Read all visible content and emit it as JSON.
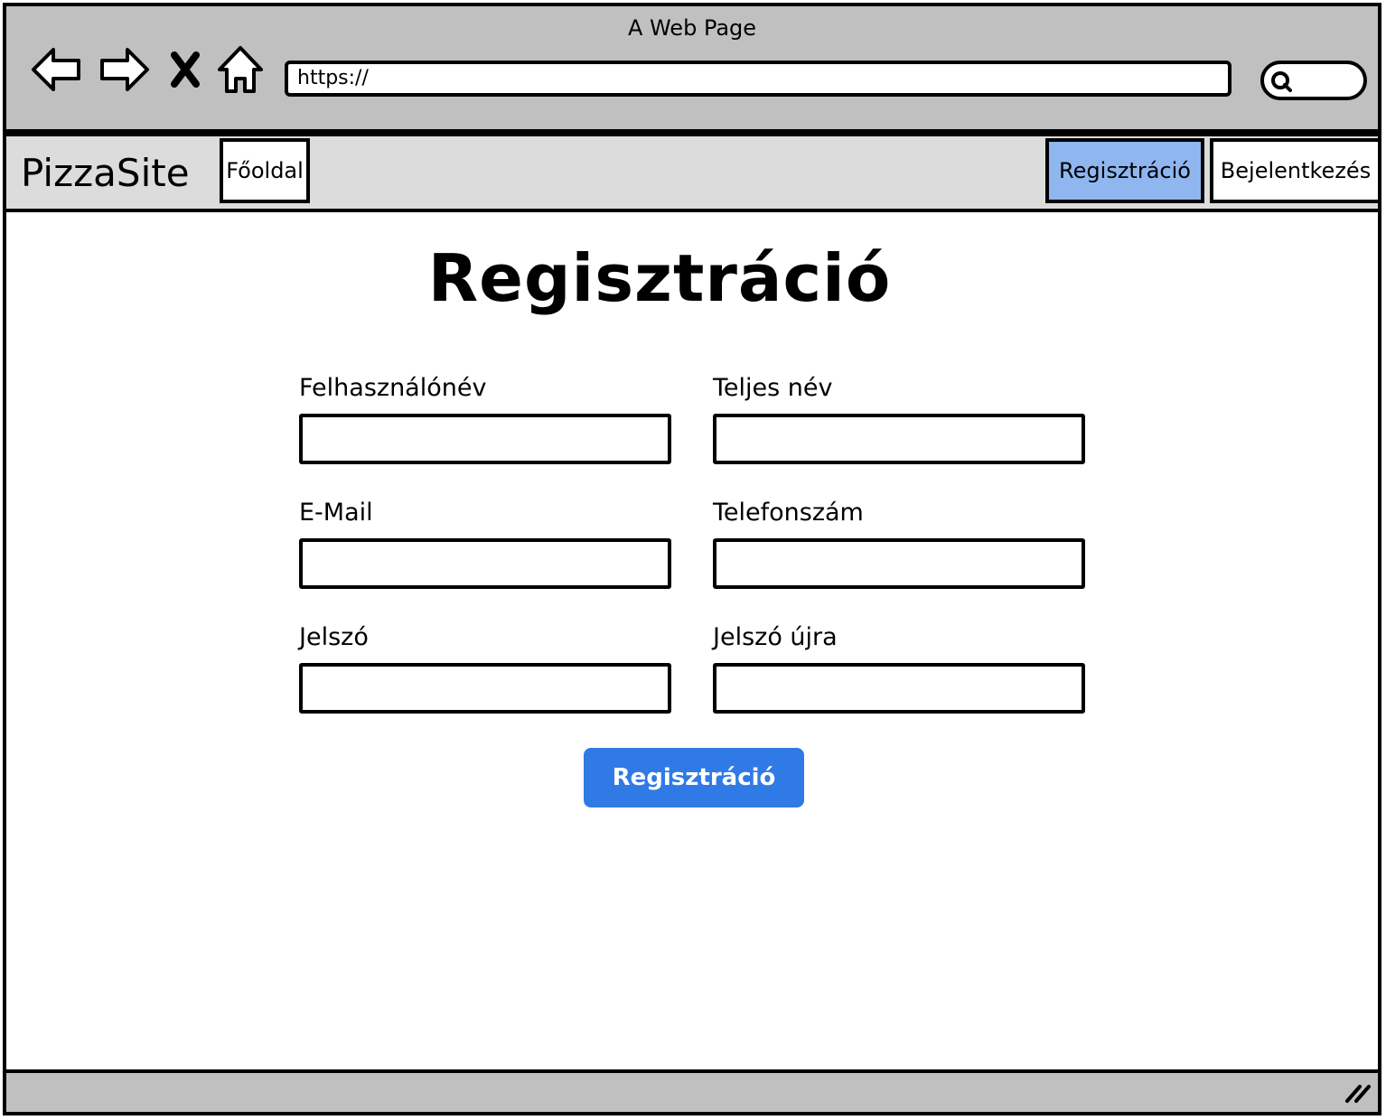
{
  "window": {
    "title": "A Web Page"
  },
  "browser": {
    "url": "https://",
    "icons": [
      "back-arrow-icon",
      "forward-arrow-icon",
      "close-x-icon",
      "home-icon",
      "search-icon"
    ]
  },
  "nav": {
    "brand": "PizzaSite",
    "home": "Főoldal",
    "register": "Regisztráció",
    "login": "Bejelentkezés",
    "active": "register",
    "active_color": "#8fb6ef"
  },
  "main": {
    "title": "Regisztráció",
    "fields": {
      "username": {
        "label": "Felhasználónév",
        "value": ""
      },
      "fullname": {
        "label": "Teljes név",
        "value": ""
      },
      "email": {
        "label": "E-Mail",
        "value": ""
      },
      "phone": {
        "label": "Telefonszám",
        "value": ""
      },
      "password": {
        "label": "Jelszó",
        "value": ""
      },
      "password_again": {
        "label": "Jelszó újra",
        "value": ""
      }
    },
    "submit": {
      "label": "Regisztráció",
      "color": "#2f7ae5"
    }
  }
}
